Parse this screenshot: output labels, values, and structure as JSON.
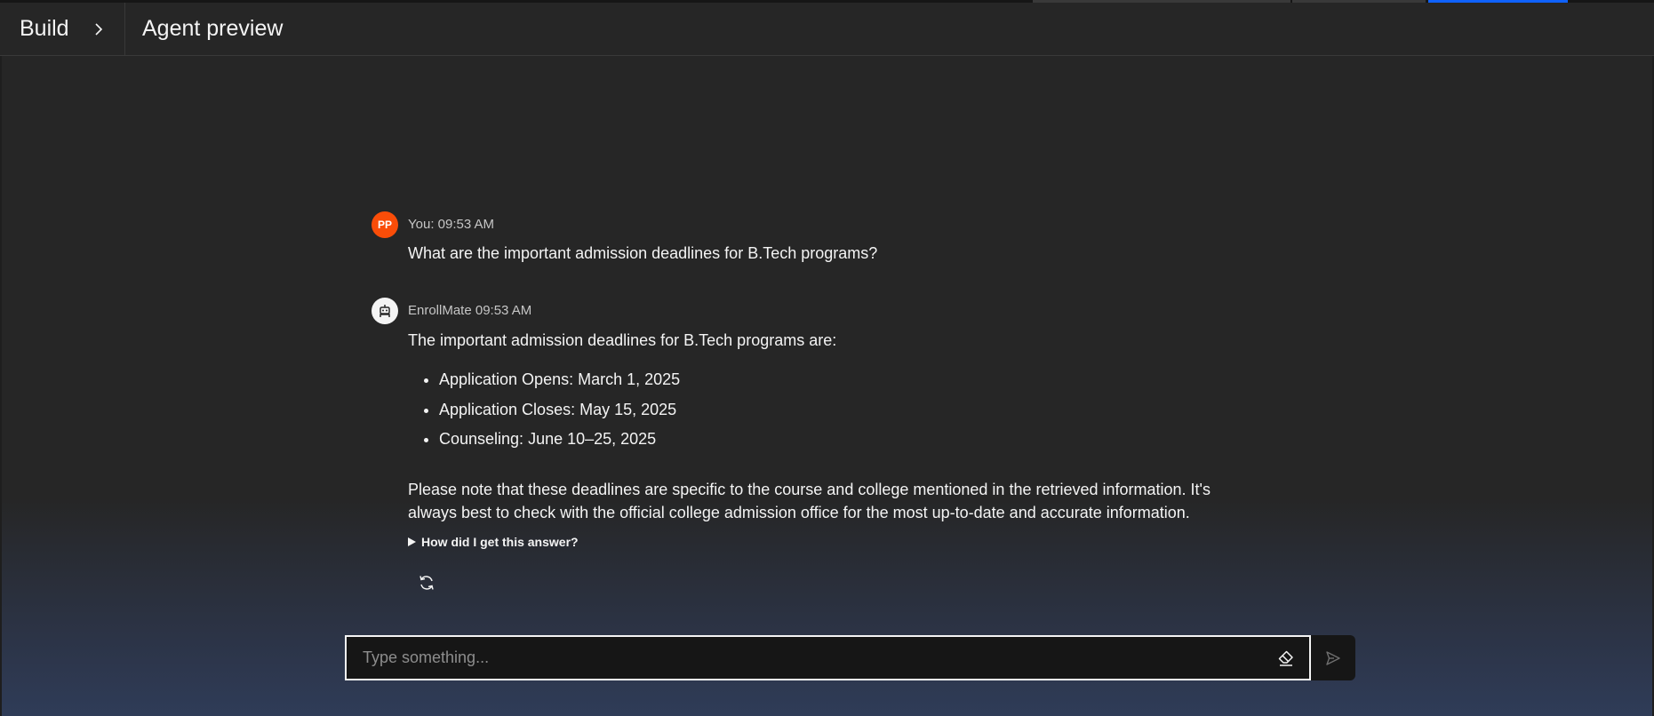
{
  "header": {
    "breadcrumb_build": "Build",
    "title": "Agent preview"
  },
  "conversation": {
    "user_message": {
      "avatar_initials": "PP",
      "meta": "You: 09:53 AM",
      "text": "What are the important admission deadlines for B.Tech programs?"
    },
    "bot_message": {
      "meta": "EnrollMate 09:53 AM",
      "intro": "The important admission deadlines for B.Tech programs are:",
      "bullets": [
        "Application Opens: March 1, 2025",
        "Application Closes: May 15, 2025",
        "Counseling: June 10–25, 2025"
      ],
      "note_line1": "Please note that these deadlines are specific to the course and college mentioned in the retrieved information. It's",
      "note_line2": "always best to check with the official college admission office for the most up-to-date and accurate information.",
      "explain_label": "How did I get this answer?"
    }
  },
  "composer": {
    "placeholder": "Type something..."
  },
  "colors": {
    "accent": "#0f62fe",
    "user_avatar": "#fa4d08",
    "background": "#262626"
  },
  "icons": {
    "breadcrumb_separator": "chevron-right-icon",
    "bot_avatar": "robot-icon",
    "explain_toggle": "caret-right-icon",
    "regenerate": "renew-icon",
    "clear": "eraser-icon",
    "send": "send-icon"
  }
}
